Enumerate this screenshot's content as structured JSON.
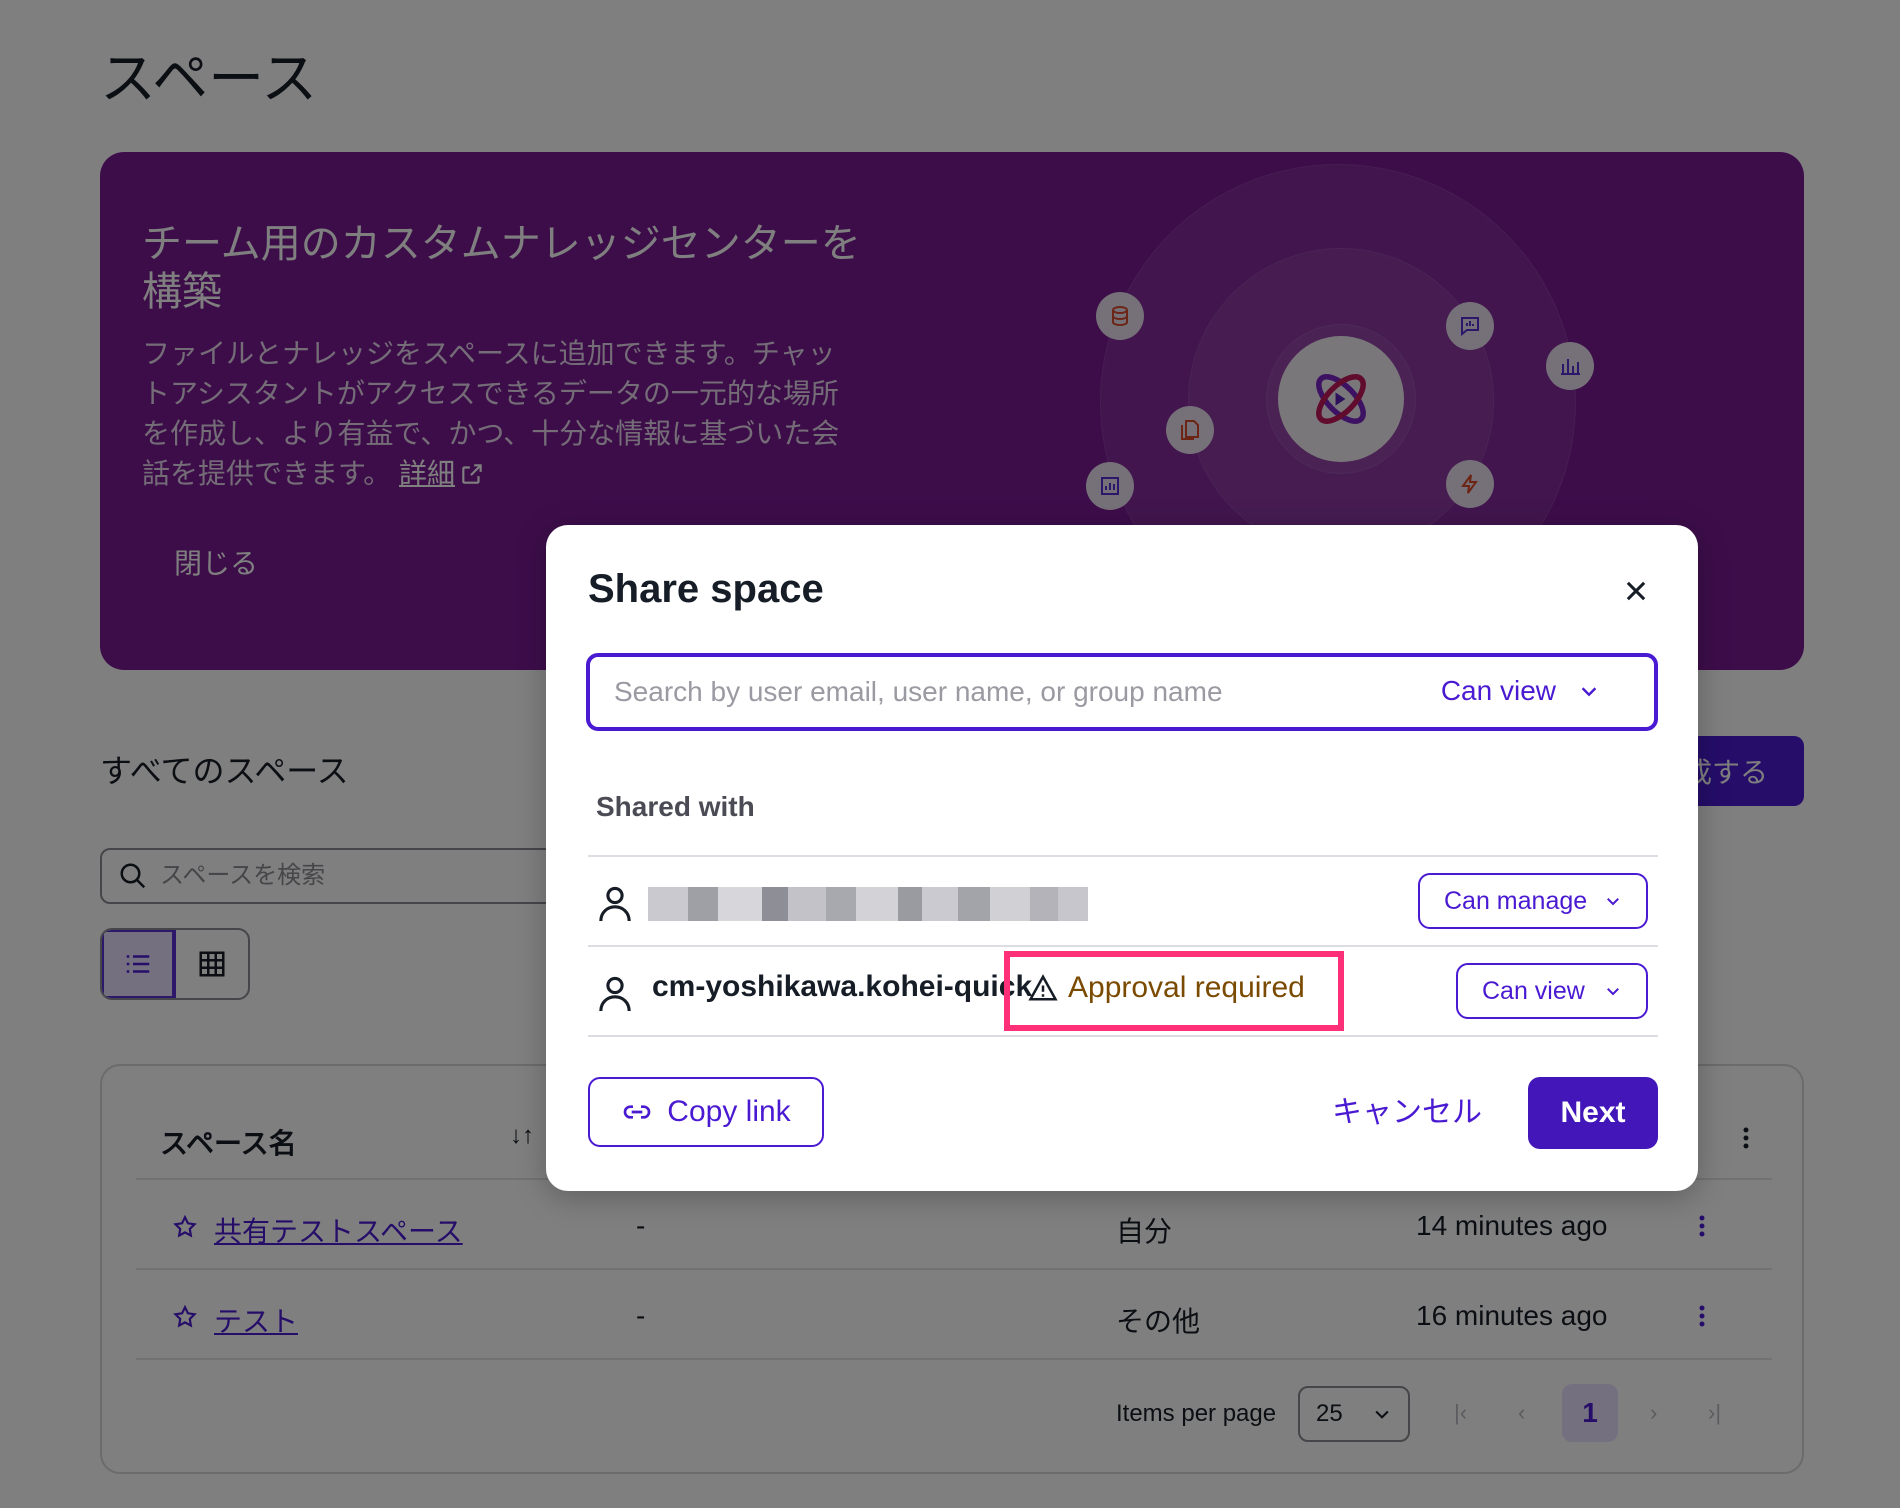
{
  "page": {
    "title": "スペース"
  },
  "banner": {
    "heading": "チーム用のカスタムナレッジセンターを構築",
    "body": "ファイルとナレッジをスペースに追加できます。チャットアシスタントがアクセスできるデータの一元的な場所を作成し、より有益で、かつ、十分な情報に基づいた会話を提供できます。",
    "link_label": "詳細",
    "close_label": "閉じる"
  },
  "spaces": {
    "section_title": "すべてのスペース",
    "create_label": "成する",
    "search_placeholder": "スペースを検索",
    "table": {
      "header_name": "スペース名",
      "rows": [
        {
          "name": "共有テストスペース",
          "desc": "-",
          "owner": "自分",
          "updated": "14 minutes ago"
        },
        {
          "name": "テスト",
          "desc": "-",
          "owner": "その他",
          "updated": "16 minutes ago"
        }
      ]
    },
    "pagination": {
      "items_per_page_label": "Items per page",
      "items_per_page_value": "25",
      "current_page": "1"
    }
  },
  "modal": {
    "title": "Share space",
    "search_placeholder": "Search by user email, user name, or group name",
    "default_permission": "Can view",
    "shared_with_label": "Shared with",
    "users": [
      {
        "name": "",
        "role": "Can manage"
      },
      {
        "name": "cm-yoshikawa.kohei-quick",
        "role": "Can view",
        "status": "Approval required"
      }
    ],
    "copy_link_label": "Copy link",
    "cancel_label": "キャンセル",
    "next_label": "Next"
  },
  "colors": {
    "accent": "#4a1ad2",
    "banner": "#7b1b95",
    "highlight": "#ff2f78",
    "warning": "#7a4a00"
  }
}
